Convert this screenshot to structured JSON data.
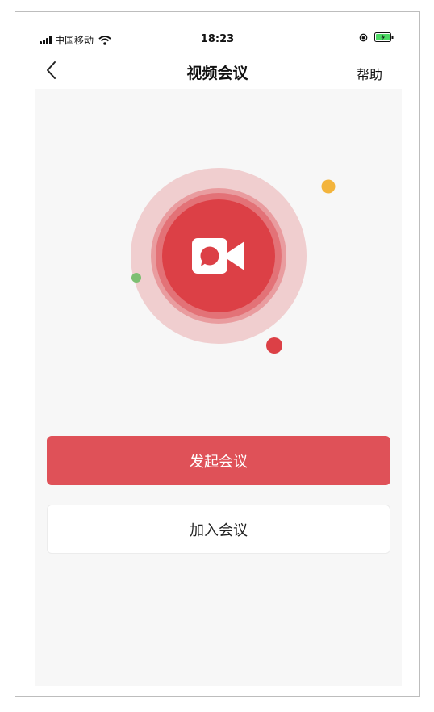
{
  "status_bar": {
    "carrier": "中国移动",
    "time": "18:23"
  },
  "nav": {
    "title": "视频会议",
    "help_label": "帮助"
  },
  "actions": {
    "start_label": "发起会议",
    "join_label": "加入会议"
  },
  "icons": {
    "back": "chevron-left-icon",
    "hero": "video-camera-icon"
  },
  "colors": {
    "accent": "#df5158",
    "hero_red": "#dc4046",
    "dot_yellow": "#f3b43c",
    "dot_green": "#7dbf72",
    "background": "#f7f7f7"
  }
}
